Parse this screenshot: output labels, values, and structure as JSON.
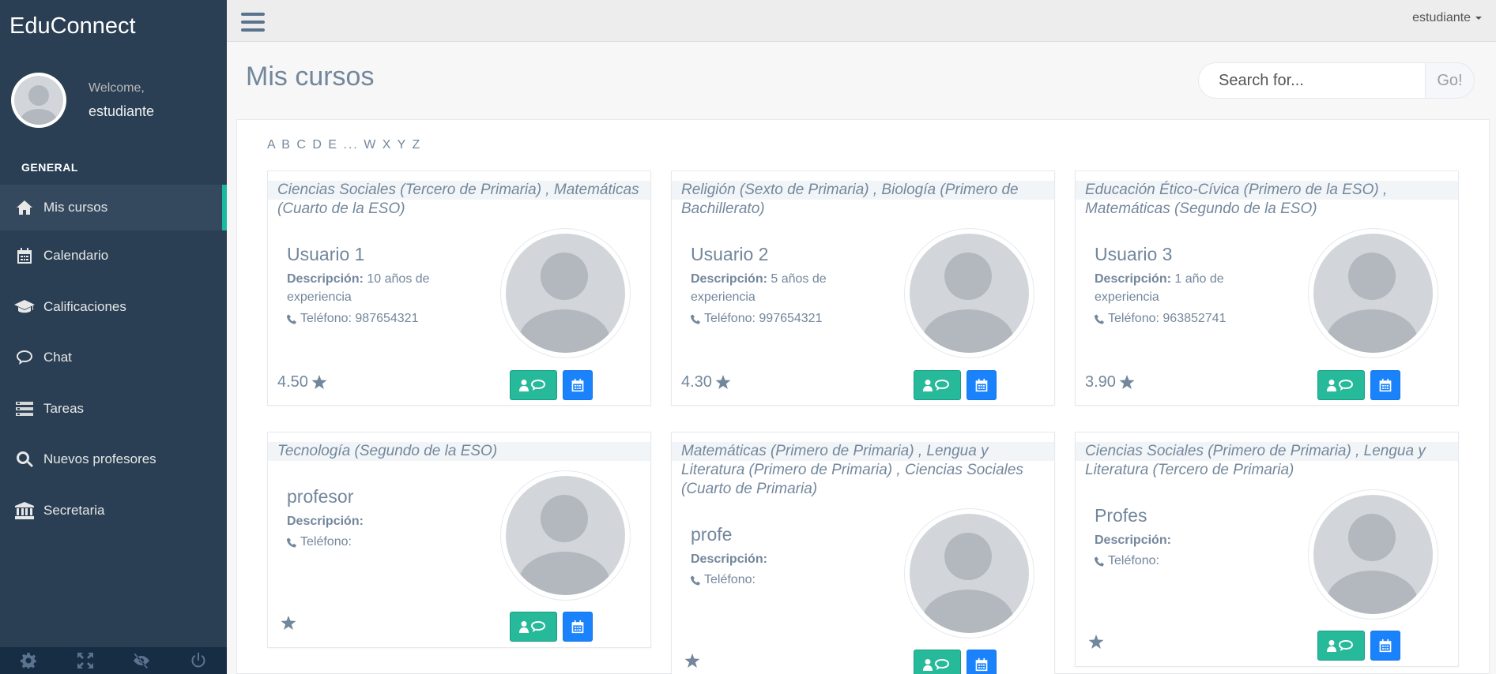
{
  "app": {
    "brand": "EduConnect"
  },
  "profile": {
    "welcome": "Welcome,",
    "username": "estudiante"
  },
  "sidebar": {
    "section_title": "GENERAL",
    "items": [
      {
        "label": "Mis cursos",
        "icon": "home-icon",
        "active": true
      },
      {
        "label": "Calendario",
        "icon": "calendar-icon"
      },
      {
        "label": "Calificaciones",
        "icon": "graduation-cap-icon"
      },
      {
        "label": "Chat",
        "icon": "chat-bubble-icon"
      },
      {
        "label": "Tareas",
        "icon": "tasks-icon"
      },
      {
        "label": "Nuevos profesores",
        "icon": "search-icon"
      },
      {
        "label": "Secretaria",
        "icon": "bank-icon"
      }
    ],
    "footer_icons": [
      "settings-icon",
      "fullscreen-icon",
      "hide-icon",
      "logout-icon"
    ]
  },
  "topnav": {
    "user_label": "estudiante"
  },
  "page": {
    "title": "Mis cursos"
  },
  "search": {
    "placeholder": "Search for...",
    "button_label": "Go!"
  },
  "alphabet": "A B C D E ... W X Y Z",
  "labels": {
    "description": "Descripción:",
    "phone": "Teléfono:"
  },
  "teachers": [
    {
      "subjects": "Ciencias Sociales (Tercero de Primaria) , Matemáticas (Cuarto de la ESO)",
      "name": "Usuario 1",
      "description": "10 años de experiencia",
      "phone": "987654321",
      "rating": "4.50"
    },
    {
      "subjects": "Religión (Sexto de Primaria) , Biología (Primero de Bachillerato)",
      "name": "Usuario 2",
      "description": "5 años de experiencia",
      "phone": "997654321",
      "rating": "4.30"
    },
    {
      "subjects": "Educación Ético-Cívica (Primero de la ESO) , Matemáticas (Segundo de la ESO)",
      "name": "Usuario 3",
      "description": "1 año de experiencia",
      "phone": "963852741",
      "rating": "3.90"
    },
    {
      "subjects": "Tecnología (Segundo de la ESO)",
      "name": "profesor",
      "description": "",
      "phone": "",
      "rating": ""
    },
    {
      "subjects": "Matemáticas (Primero de Primaria) , Lengua y Literatura (Primero de Primaria) , Ciencias Sociales (Cuarto de Primaria)",
      "name": "profe",
      "description": "",
      "phone": "",
      "rating": ""
    },
    {
      "subjects": "Ciencias Sociales (Primero de Primaria) , Lengua y Literatura (Tercero de Primaria)",
      "name": "Profes",
      "description": "",
      "phone": "",
      "rating": ""
    }
  ],
  "colors": {
    "sidebar_bg": "#2a3f54",
    "accent": "#1abb9c",
    "chat_button": "#26b99a",
    "calendar_button": "#1a82fb"
  }
}
